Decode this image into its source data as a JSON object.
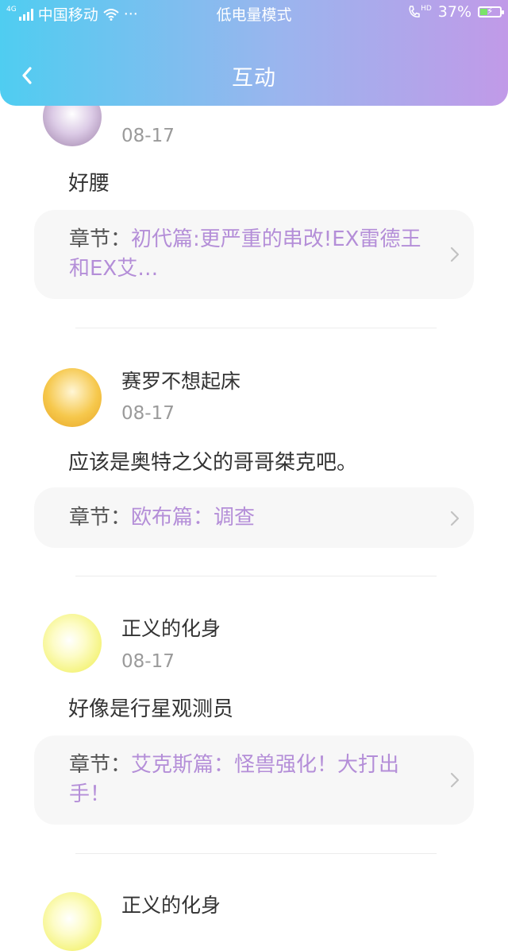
{
  "status_bar": {
    "network": "4G",
    "carrier": "中国移动",
    "more": "···",
    "mode": "低电量模式",
    "hd": "HD",
    "battery": "37%",
    "battery_level": 0.37
  },
  "nav": {
    "title": "互动"
  },
  "entries": [
    {
      "username": "",
      "date": "08-17",
      "content": "好腰",
      "chapter_prefix": "章节：",
      "chapter_title": "初代篇:更严重的串改!EX雷德王和EX艾…"
    },
    {
      "username": "赛罗不想起床",
      "date": "08-17",
      "content": "应该是奥特之父的哥哥桀克吧。",
      "chapter_prefix": "章节：",
      "chapter_title": "欧布篇：调查"
    },
    {
      "username": "正义的化身",
      "date": "08-17",
      "content": "好像是行星观测员",
      "chapter_prefix": "章节：",
      "chapter_title": "艾克斯篇：怪兽强化！大打出手！"
    },
    {
      "username": "正义的化身"
    }
  ],
  "icons": {
    "back": "chevron-left-icon",
    "chapter_arrow": "chevron-right-icon"
  },
  "colors": {
    "header_gradient_start": "#4fcdf1",
    "header_gradient_end": "#c19ae8",
    "chapter_link": "#b48ed8",
    "date_gray": "#9a9a9a"
  }
}
